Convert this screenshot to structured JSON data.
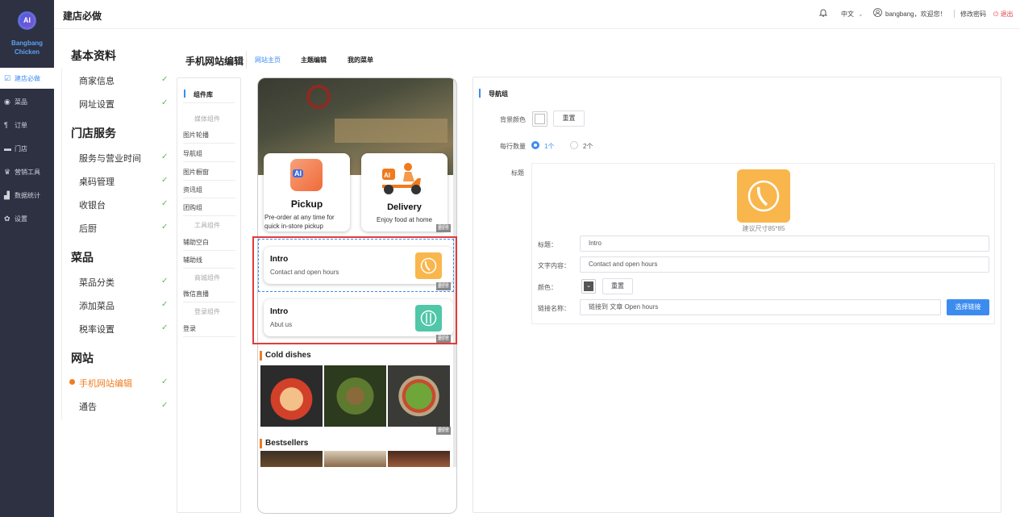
{
  "app": {
    "logo_text": "AI",
    "brand_line1": "Bangbang",
    "brand_line2": "Chicken",
    "title": "建店必做"
  },
  "nav": [
    {
      "label": "建店必做",
      "icon": "check-square-icon",
      "glyph": "☑"
    },
    {
      "label": "菜品",
      "icon": "dish-icon",
      "glyph": "◉"
    },
    {
      "label": "订单",
      "icon": "utensils-icon",
      "glyph": "¶"
    },
    {
      "label": "门店",
      "icon": "store-icon",
      "glyph": "▬"
    },
    {
      "label": "营销工具",
      "icon": "crown-icon",
      "glyph": "♛"
    },
    {
      "label": "数据统计",
      "icon": "bar-chart-icon",
      "glyph": "▟"
    },
    {
      "label": "设置",
      "icon": "gear-icon",
      "glyph": "✿"
    }
  ],
  "topbar": {
    "language": "中文",
    "user_greeting": "bangbang，欢迎您！",
    "change_password": "修改密码",
    "logout": "退出"
  },
  "menu": [
    {
      "header": "基本资料",
      "items": [
        "商家信息",
        "网址设置"
      ]
    },
    {
      "header": "门店服务",
      "items": [
        "服务与营业时间",
        "桌码管理",
        "收银台",
        "后厨"
      ]
    },
    {
      "header": "菜品",
      "items": [
        "菜品分类",
        "添加菜品",
        "税率设置"
      ]
    },
    {
      "header": "网站",
      "items": [
        "手机网站编辑",
        "通告"
      ]
    }
  ],
  "editor": {
    "title": "手机网站编辑",
    "tabs": [
      "网站主页",
      "主题编辑",
      "我的菜单"
    ]
  },
  "components": {
    "title": "组件库",
    "group_media": "媒体组件",
    "media": [
      "图片轮播",
      "导航组",
      "图片橱窗",
      "资讯组",
      "团购组"
    ],
    "group_tools": "工具组件",
    "tools": [
      "辅助空白",
      "辅助线"
    ],
    "group_mall": "商城组件",
    "mall": [
      "微信直播"
    ],
    "group_login": "登录组件",
    "login": [
      "登录"
    ]
  },
  "preview": {
    "pickup_title": "Pickup",
    "pickup_desc": "Pre-order at any time for quick in-store pickup",
    "delivery_title": "Delivery",
    "delivery_desc": "Enjoy food at home",
    "delete_label": "删除",
    "intro1_title": "Intro",
    "intro1_desc": "Contact and open hours",
    "intro2_title": "Intro",
    "intro2_desc": "Abut us",
    "section1": "Cold dishes",
    "section2": "Bestsellers",
    "badge_text": "AI"
  },
  "panel": {
    "title": "导航组",
    "bg_color_label": "背景颜色",
    "reset": "重置",
    "per_row_label": "每行数量",
    "opt1": "1个",
    "opt2": "2个",
    "heading_label": "标题",
    "size_hint": "建议尺寸85*85",
    "field_title_label": "标题：",
    "field_title_value": "Intro",
    "field_text_label": "文字内容：",
    "field_text_value": "Contact and open hours",
    "field_color_label": "颜色：",
    "field_link_label": "链接名称：",
    "field_link_value": "链接到 文章 Open hours",
    "select_link": "选择链接"
  },
  "colors": {
    "accent": "#3c8cf0",
    "nav_bg": "#2d3142",
    "orange": "#ef7d22",
    "intro_icon1": "#f9b64d",
    "intro_icon2": "#4fc7a8",
    "check": "#5cb85c"
  }
}
